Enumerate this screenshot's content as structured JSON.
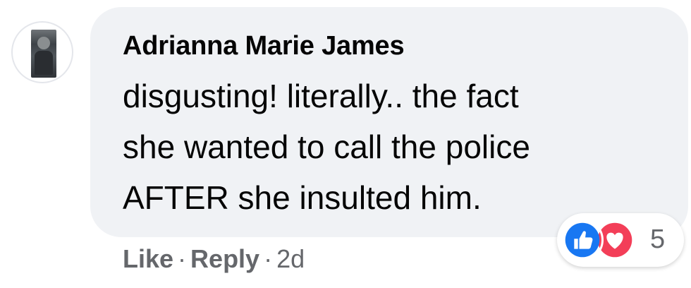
{
  "comment": {
    "author": "Adrianna Marie James",
    "text_lines": [
      "disgusting! literally.. the fact",
      "she wanted to call the police",
      "AFTER she insulted him."
    ],
    "actions": {
      "like_label": "Like",
      "separator": "·",
      "reply_label": "Reply",
      "time": "2d"
    },
    "reactions": {
      "icons": [
        "like-icon",
        "love-icon"
      ],
      "count": "5",
      "like_color": "#1877f2",
      "love_color": "#f33e58"
    }
  }
}
